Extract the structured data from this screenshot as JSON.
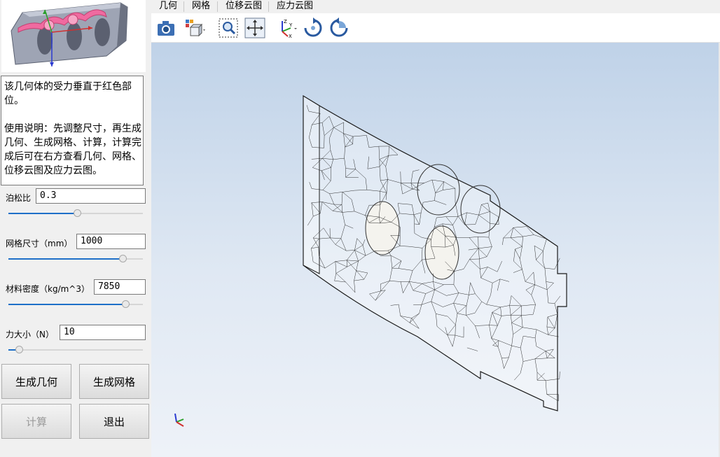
{
  "sidebar": {
    "description": {
      "line1": "该几何体的受力垂直于红色部位。",
      "line2": "使用说明：先调整尺寸，再生成几何、生成网格、计算，计算完成后可在右方查看几何、网格、位移云图及应力云图。"
    },
    "params": {
      "poisson": {
        "label": "泊松比",
        "value": "0.3",
        "slider": 0.51
      },
      "mesh_size": {
        "label": "网格尺寸（mm）",
        "value": "1000",
        "slider": 0.85
      },
      "density": {
        "label": "材料密度（kg/m^3）",
        "value": "7850",
        "slider": 0.87
      },
      "force": {
        "label": "力大小（N）",
        "value": "10",
        "slider": 0.08
      }
    },
    "buttons": {
      "gen_geometry": "生成几何",
      "gen_mesh": "生成网格",
      "calculate": "计算",
      "exit": "退出"
    }
  },
  "tabs": [
    "几何",
    "网格",
    "位移云图",
    "应力云图"
  ],
  "toolbar": {
    "icons": [
      "camera-icon",
      "view-cube-icon",
      "zoom-box-icon",
      "pan-icon",
      "axes-icon",
      "rotate-cw-icon",
      "rotate-ccw-icon"
    ]
  },
  "viewport": {
    "background_top": "#bfd2e8",
    "background_bottom": "#eef2f8",
    "axis_colors": {
      "x": "#d03030",
      "y": "#2aa02a",
      "z": "#2a3ad0"
    }
  },
  "colors": {
    "accent": "#1e6fc8",
    "highlight": "#f06aa0"
  }
}
